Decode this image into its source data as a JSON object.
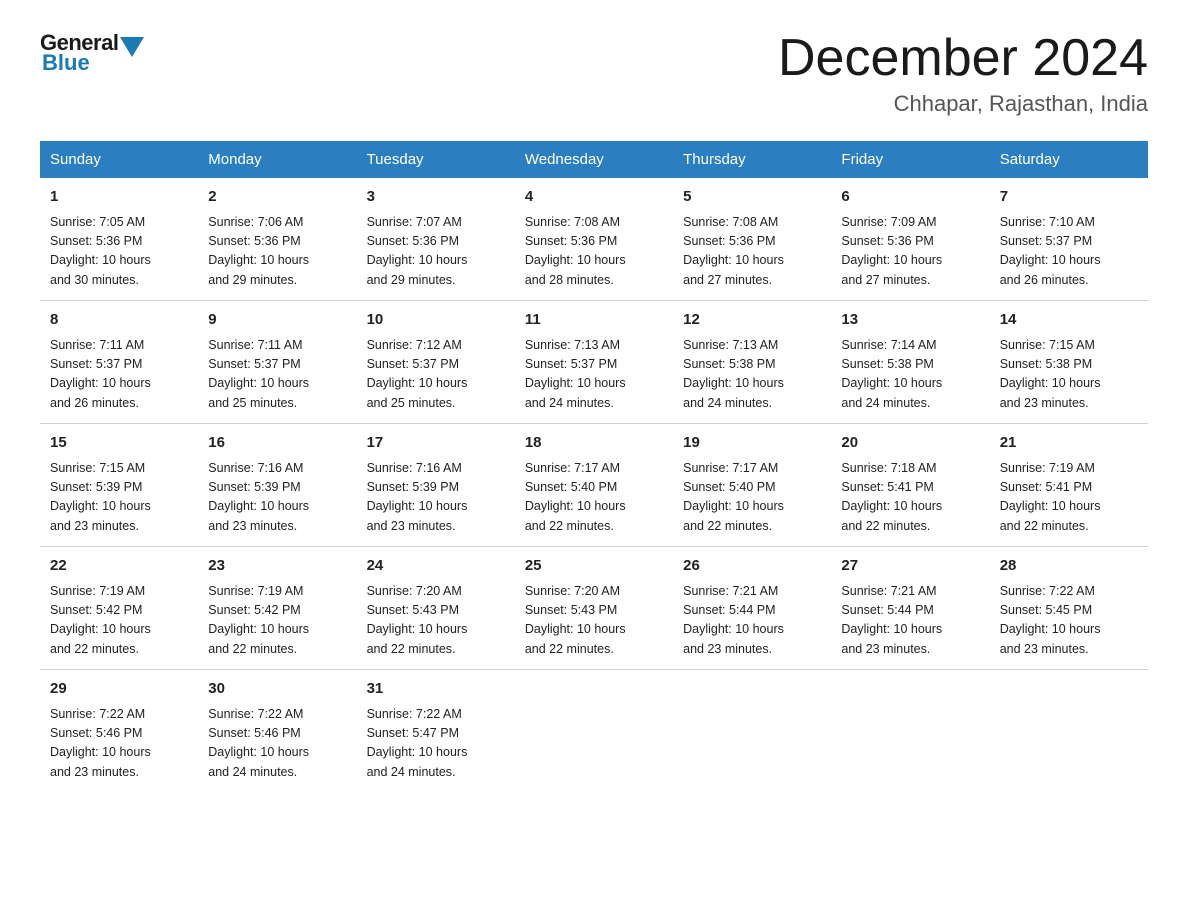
{
  "header": {
    "logo_general": "General",
    "logo_blue": "Blue",
    "month_title": "December 2024",
    "location": "Chhapar, Rajasthan, India"
  },
  "weekdays": [
    "Sunday",
    "Monday",
    "Tuesday",
    "Wednesday",
    "Thursday",
    "Friday",
    "Saturday"
  ],
  "weeks": [
    [
      {
        "day": "1",
        "sunrise": "7:05 AM",
        "sunset": "5:36 PM",
        "daylight": "10 hours and 30 minutes."
      },
      {
        "day": "2",
        "sunrise": "7:06 AM",
        "sunset": "5:36 PM",
        "daylight": "10 hours and 29 minutes."
      },
      {
        "day": "3",
        "sunrise": "7:07 AM",
        "sunset": "5:36 PM",
        "daylight": "10 hours and 29 minutes."
      },
      {
        "day": "4",
        "sunrise": "7:08 AM",
        "sunset": "5:36 PM",
        "daylight": "10 hours and 28 minutes."
      },
      {
        "day": "5",
        "sunrise": "7:08 AM",
        "sunset": "5:36 PM",
        "daylight": "10 hours and 27 minutes."
      },
      {
        "day": "6",
        "sunrise": "7:09 AM",
        "sunset": "5:36 PM",
        "daylight": "10 hours and 27 minutes."
      },
      {
        "day": "7",
        "sunrise": "7:10 AM",
        "sunset": "5:37 PM",
        "daylight": "10 hours and 26 minutes."
      }
    ],
    [
      {
        "day": "8",
        "sunrise": "7:11 AM",
        "sunset": "5:37 PM",
        "daylight": "10 hours and 26 minutes."
      },
      {
        "day": "9",
        "sunrise": "7:11 AM",
        "sunset": "5:37 PM",
        "daylight": "10 hours and 25 minutes."
      },
      {
        "day": "10",
        "sunrise": "7:12 AM",
        "sunset": "5:37 PM",
        "daylight": "10 hours and 25 minutes."
      },
      {
        "day": "11",
        "sunrise": "7:13 AM",
        "sunset": "5:37 PM",
        "daylight": "10 hours and 24 minutes."
      },
      {
        "day": "12",
        "sunrise": "7:13 AM",
        "sunset": "5:38 PM",
        "daylight": "10 hours and 24 minutes."
      },
      {
        "day": "13",
        "sunrise": "7:14 AM",
        "sunset": "5:38 PM",
        "daylight": "10 hours and 24 minutes."
      },
      {
        "day": "14",
        "sunrise": "7:15 AM",
        "sunset": "5:38 PM",
        "daylight": "10 hours and 23 minutes."
      }
    ],
    [
      {
        "day": "15",
        "sunrise": "7:15 AM",
        "sunset": "5:39 PM",
        "daylight": "10 hours and 23 minutes."
      },
      {
        "day": "16",
        "sunrise": "7:16 AM",
        "sunset": "5:39 PM",
        "daylight": "10 hours and 23 minutes."
      },
      {
        "day": "17",
        "sunrise": "7:16 AM",
        "sunset": "5:39 PM",
        "daylight": "10 hours and 23 minutes."
      },
      {
        "day": "18",
        "sunrise": "7:17 AM",
        "sunset": "5:40 PM",
        "daylight": "10 hours and 22 minutes."
      },
      {
        "day": "19",
        "sunrise": "7:17 AM",
        "sunset": "5:40 PM",
        "daylight": "10 hours and 22 minutes."
      },
      {
        "day": "20",
        "sunrise": "7:18 AM",
        "sunset": "5:41 PM",
        "daylight": "10 hours and 22 minutes."
      },
      {
        "day": "21",
        "sunrise": "7:19 AM",
        "sunset": "5:41 PM",
        "daylight": "10 hours and 22 minutes."
      }
    ],
    [
      {
        "day": "22",
        "sunrise": "7:19 AM",
        "sunset": "5:42 PM",
        "daylight": "10 hours and 22 minutes."
      },
      {
        "day": "23",
        "sunrise": "7:19 AM",
        "sunset": "5:42 PM",
        "daylight": "10 hours and 22 minutes."
      },
      {
        "day": "24",
        "sunrise": "7:20 AM",
        "sunset": "5:43 PM",
        "daylight": "10 hours and 22 minutes."
      },
      {
        "day": "25",
        "sunrise": "7:20 AM",
        "sunset": "5:43 PM",
        "daylight": "10 hours and 22 minutes."
      },
      {
        "day": "26",
        "sunrise": "7:21 AM",
        "sunset": "5:44 PM",
        "daylight": "10 hours and 23 minutes."
      },
      {
        "day": "27",
        "sunrise": "7:21 AM",
        "sunset": "5:44 PM",
        "daylight": "10 hours and 23 minutes."
      },
      {
        "day": "28",
        "sunrise": "7:22 AM",
        "sunset": "5:45 PM",
        "daylight": "10 hours and 23 minutes."
      }
    ],
    [
      {
        "day": "29",
        "sunrise": "7:22 AM",
        "sunset": "5:46 PM",
        "daylight": "10 hours and 23 minutes."
      },
      {
        "day": "30",
        "sunrise": "7:22 AM",
        "sunset": "5:46 PM",
        "daylight": "10 hours and 24 minutes."
      },
      {
        "day": "31",
        "sunrise": "7:22 AM",
        "sunset": "5:47 PM",
        "daylight": "10 hours and 24 minutes."
      },
      null,
      null,
      null,
      null
    ]
  ],
  "labels": {
    "sunrise": "Sunrise:",
    "sunset": "Sunset:",
    "daylight": "Daylight:"
  }
}
